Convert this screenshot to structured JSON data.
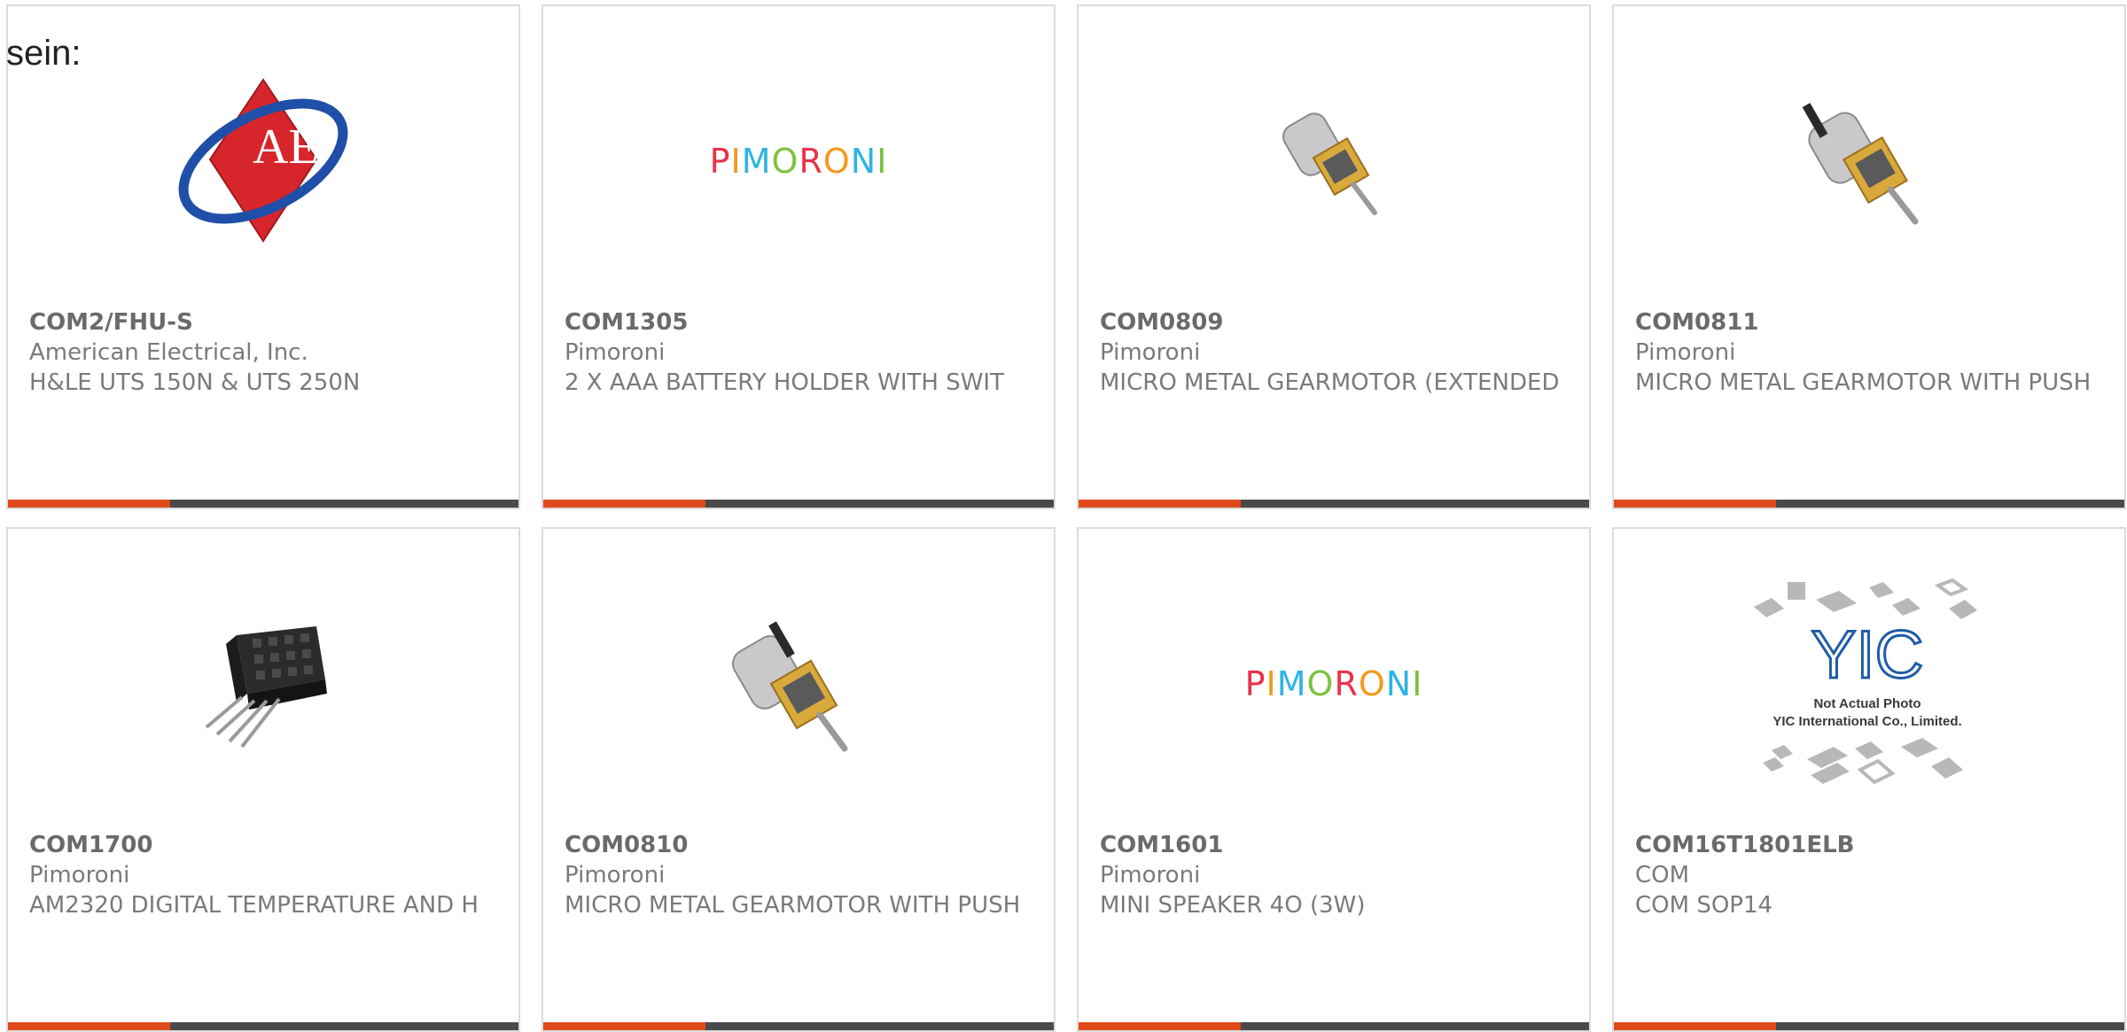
{
  "lead_text": "sein:",
  "colors": {
    "accent": "#e04a1a",
    "bar": "#4a4a4a",
    "card_border": "#dcdcdc",
    "text": "#7a7a7a"
  },
  "products": [
    {
      "part": "COM2/FHU-S",
      "manufacturer": "American Electrical, Inc.",
      "description": "H&LE UTS 150N & UTS 250N",
      "image": "american-electrical-logo",
      "image_text": "AE"
    },
    {
      "part": "COM1305",
      "manufacturer": "Pimoroni",
      "description": "2 X AAA BATTERY HOLDER WITH SWIT",
      "image": "pimoroni-logo",
      "image_text": "PIMORONI"
    },
    {
      "part": "COM0809",
      "manufacturer": "Pimoroni",
      "description": "MICRO METAL GEARMOTOR (EXTENDED",
      "image": "gearmotor-photo"
    },
    {
      "part": "COM0811",
      "manufacturer": "Pimoroni",
      "description": "MICRO METAL GEARMOTOR WITH PUSH",
      "image": "gearmotor-photo"
    },
    {
      "part": "COM1700",
      "manufacturer": "Pimoroni",
      "description": "AM2320 DIGITAL TEMPERATURE AND H",
      "image": "sensor-photo"
    },
    {
      "part": "COM0810",
      "manufacturer": "Pimoroni",
      "description": "MICRO METAL GEARMOTOR WITH PUSH",
      "image": "gearmotor-photo"
    },
    {
      "part": "COM1601",
      "manufacturer": "Pimoroni",
      "description": "MINI SPEAKER 4O (3W)",
      "image": "pimoroni-logo",
      "image_text": "PIMORONI"
    },
    {
      "part": "COM16T1801ELB",
      "manufacturer": "COM",
      "description": "COM SOP14",
      "image": "yic-placeholder",
      "image_text": "YIC",
      "image_caption_1": "Not Actual Photo",
      "image_caption_2": "YIC International Co., Limited."
    }
  ]
}
